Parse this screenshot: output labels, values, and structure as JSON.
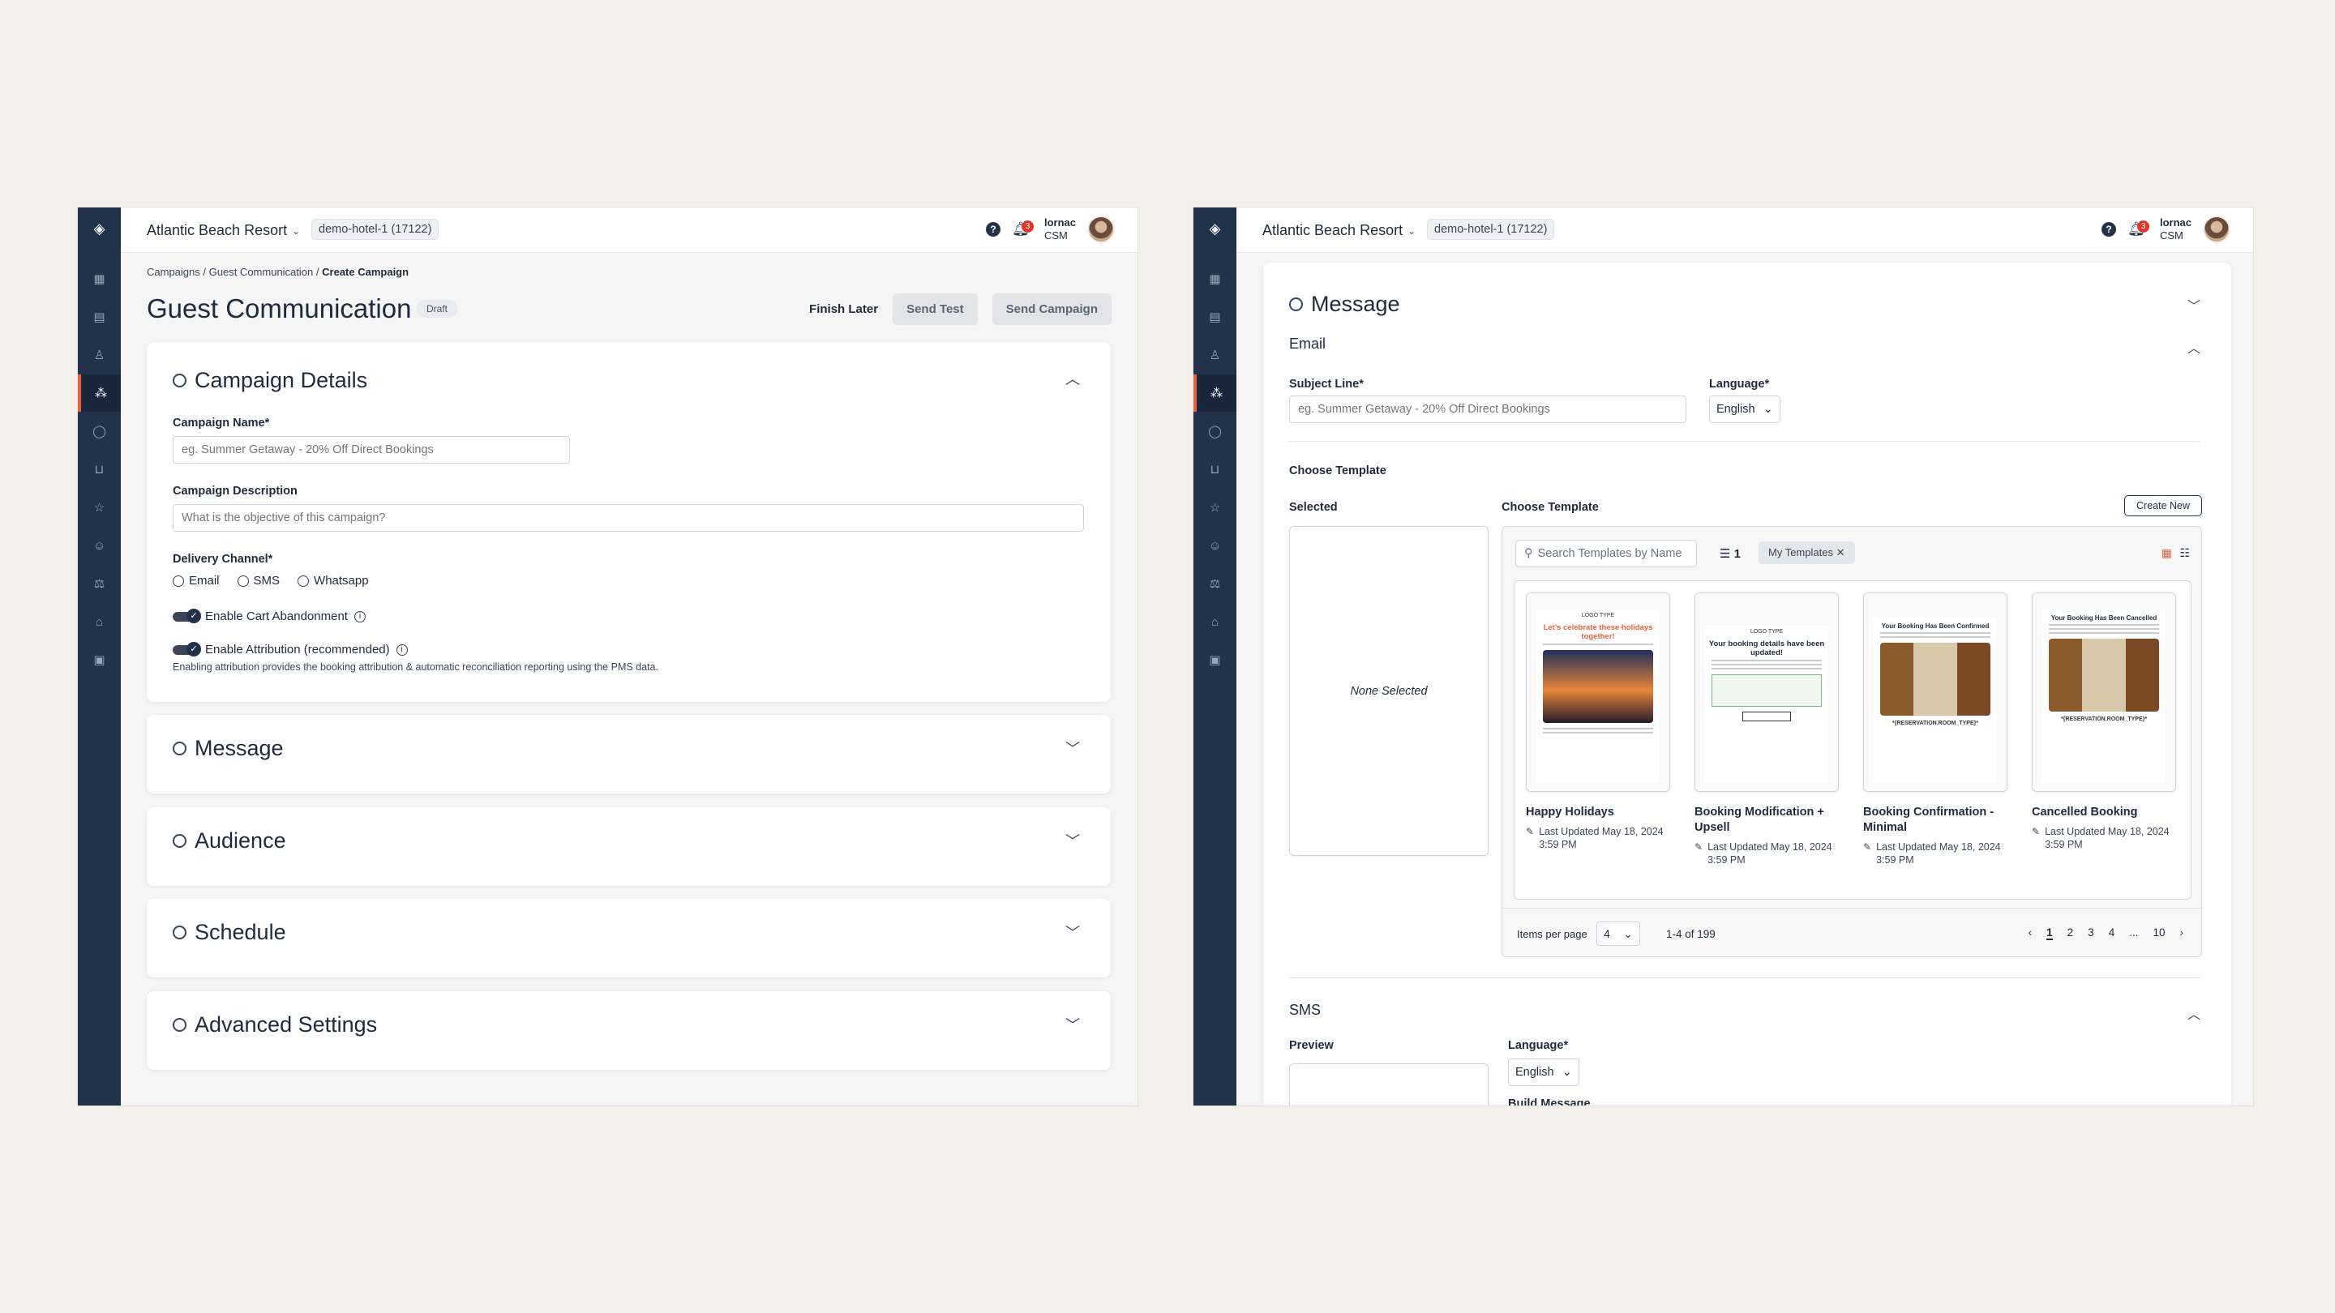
{
  "app": {
    "hotel_name": "Atlantic Beach Resort",
    "hotel_id": "demo-hotel-1 (17122)",
    "notification_count": "3",
    "user_name": "lornac",
    "user_role": "CSM",
    "colors": {
      "sidebar": "#23324b",
      "accent": "#e8633a",
      "badge": "#e0352b"
    }
  },
  "sidebar_icons": [
    "dashboard-icon",
    "clipboard-icon",
    "user-icon",
    "campaign-icon",
    "chat-icon",
    "inbox-icon",
    "star-icon",
    "bot-icon",
    "segments-icon",
    "hotel-icon",
    "id-card-icon"
  ],
  "screenA": {
    "breadcrumb": {
      "item1": "Campaigns",
      "sep": "/",
      "item2": "Guest Communication",
      "item3": "Create Campaign"
    },
    "title": "Guest Communication",
    "status": "Draft",
    "finish_later": "Finish Later",
    "send_test": "Send Test",
    "send_campaign": "Send Campaign",
    "details": {
      "title": "Campaign Details",
      "name_label": "Campaign Name*",
      "name_placeholder": "eg. Summer Getaway - 20% Off Direct Bookings",
      "desc_label": "Campaign Description",
      "desc_placeholder": "What is the objective of this campaign?",
      "channel_label": "Delivery Channel*",
      "channels": [
        "Email",
        "SMS",
        "Whatsapp"
      ],
      "cart_toggle": "Enable Cart Abandonment",
      "attr_toggle": "Enable Attribution (recommended)",
      "attr_help": "Enabling attribution provides the booking attribution & automatic reconciliation reporting using the PMS data."
    },
    "sections": [
      "Message",
      "Audience",
      "Schedule",
      "Advanced Settings"
    ]
  },
  "screenB": {
    "title": "Message",
    "email_title": "Email",
    "subject_label": "Subject Line*",
    "subject_placeholder": "eg. Summer Getaway - 20% Off Direct Bookings",
    "language_label": "Language*",
    "language_value": "English",
    "choose_template_heading": "Choose Template",
    "selected_label": "Selected",
    "choose_template_label": "Choose Template",
    "create_new": "Create New",
    "none_selected": "None Selected",
    "search_placeholder": "Search Templates by Name",
    "filter_count": "1",
    "chip": "My Templates",
    "templates": [
      {
        "name": "Happy Holidays",
        "date": "Last Updated May 18, 2024 3:59 PM",
        "heading": "Let's celebrate these holidays together!",
        "logo": "LOGO TYPE"
      },
      {
        "name": "Booking Modification + Upsell",
        "date": "Last Updated May 18, 2024 3:59 PM",
        "heading": "Your booking details have been updated!",
        "logo": "LOGO TYPE"
      },
      {
        "name": "Booking Confirmation - Minimal",
        "date": "Last Updated May 18, 2024 3:59 PM",
        "heading": "Your Booking Has Been Confirmed",
        "caption": "*{RESERVATION.ROOM_TYPE}*"
      },
      {
        "name": "Cancelled Booking",
        "date": "Last Updated May 18, 2024 3:59 PM",
        "heading": "Your Booking Has Been Cancelled",
        "caption": "*{RESERVATION.ROOM_TYPE}*"
      }
    ],
    "pager": {
      "items_label": "Items per page",
      "items_value": "4",
      "range": "1-4 of 199",
      "pages": [
        "1",
        "2",
        "3",
        "4",
        "...",
        "10"
      ]
    },
    "sms_title": "SMS",
    "preview_label": "Preview",
    "sms_language_label": "Language*",
    "sms_language_value": "English",
    "build_message": "Build Message"
  }
}
